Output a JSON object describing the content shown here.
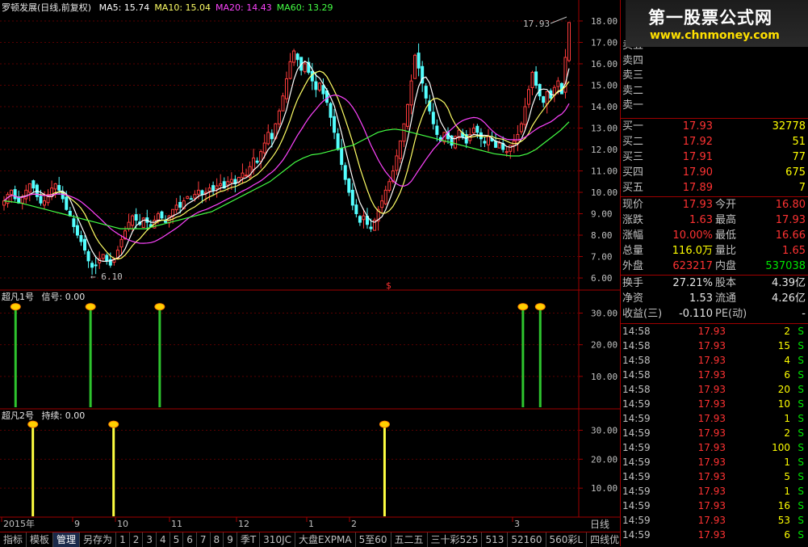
{
  "stock": {
    "name": "罗顿发展(日线,前复权)",
    "ma": [
      {
        "label": "MA5: 15.74",
        "color": "#ffffff"
      },
      {
        "label": "MA10: 15.04",
        "color": "#ffff66"
      },
      {
        "label": "MA20: 14.43",
        "color": "#ff44ff"
      },
      {
        "label": "MA60: 13.29",
        "color": "#44ff44"
      }
    ]
  },
  "chart_data": {
    "type": "candlestick",
    "price_axis": {
      "min": 5.7,
      "max": 18.3,
      "ticks": [
        "18.00",
        "17.00",
        "16.00",
        "15.00",
        "14.00",
        "13.00",
        "12.00",
        "11.00",
        "10.00",
        "9.00",
        "8.00",
        "7.00",
        "6.00"
      ]
    },
    "x_labels": [
      "2015年",
      "9",
      "10",
      "11",
      "12",
      "1",
      "2",
      "3"
    ],
    "annotations": {
      "high": "17.93",
      "low": "6.10"
    },
    "closes": [
      9.6,
      9.9,
      10.1,
      9.7,
      9.5,
      9.8,
      10.1,
      10.4,
      10.2,
      9.8,
      9.5,
      9.6,
      9.9,
      10.2,
      10.4,
      10.1,
      9.7,
      9.2,
      8.9,
      8.4,
      8.0,
      7.7,
      7.3,
      6.8,
      6.5,
      6.6,
      6.9,
      7.1,
      6.8,
      6.6,
      6.9,
      7.3,
      7.8,
      8.2,
      8.6,
      8.9,
      8.7,
      8.5,
      8.8,
      8.6,
      8.4,
      8.7,
      9.0,
      8.8,
      8.6,
      8.9,
      9.2,
      9.4,
      9.3,
      9.6,
      9.8,
      9.7,
      9.9,
      10.1,
      9.9,
      10.0,
      10.2,
      10.1,
      10.3,
      10.4,
      10.2,
      10.5,
      10.6,
      10.4,
      10.7,
      10.9,
      10.8,
      11.2,
      11.6,
      11.4,
      11.9,
      12.3,
      12.8,
      12.5,
      13.2,
      13.8,
      14.5,
      15.3,
      16.1,
      16.6,
      16.2,
      15.7,
      16.0,
      15.6,
      15.2,
      14.8,
      15.1,
      14.6,
      14.2,
      13.5,
      12.8,
      12.0,
      11.3,
      10.6,
      10.0,
      9.4,
      9.0,
      8.6,
      8.9,
      8.5,
      8.3,
      8.7,
      9.2,
      9.6,
      10.1,
      10.5,
      11.0,
      11.7,
      12.4,
      13.2,
      14.1,
      15.2,
      16.4,
      15.8,
      15.1,
      14.4,
      13.8,
      13.2,
      12.7,
      12.4,
      12.8,
      12.5,
      12.2,
      12.6,
      12.9,
      12.6,
      12.3,
      12.7,
      13.0,
      12.8,
      12.5,
      12.3,
      12.6,
      12.4,
      12.1,
      12.3,
      12.0,
      11.9,
      12.2,
      12.4,
      12.7,
      13.2,
      14.0,
      14.8,
      15.6,
      15.0,
      14.5,
      14.2,
      14.7,
      14.4,
      14.9,
      15.2,
      14.6,
      16.3,
      17.93
    ],
    "ma60": [
      9.6,
      9.55,
      9.5,
      9.4,
      9.3,
      9.2,
      9.1,
      9.0,
      8.9,
      8.8,
      8.7,
      8.6,
      8.5,
      8.4,
      8.3,
      8.3,
      8.3,
      8.3,
      8.4,
      8.5,
      8.6,
      8.7,
      8.8,
      8.9,
      9.0,
      9.1,
      9.3,
      9.5,
      9.7,
      9.9,
      10.1,
      10.3,
      10.5,
      10.8,
      11.1,
      11.4,
      11.6,
      11.75,
      11.8,
      11.9,
      12.0,
      12.1,
      12.2,
      12.4,
      12.6,
      12.8,
      12.9,
      12.95,
      12.9,
      12.8,
      12.7,
      12.6,
      12.5,
      12.4,
      12.3,
      12.2,
      12.1,
      12.0,
      11.9,
      11.8,
      11.75,
      11.7,
      11.7,
      11.8,
      12.0,
      12.3,
      12.6,
      12.9,
      13.29
    ],
    "signal1": {
      "label": "超凡1号",
      "value_label": "信号: 0.00",
      "axis_ticks": [
        "30.00",
        "20.00",
        "10.00"
      ],
      "bars": [
        2,
        15,
        27,
        90,
        93
      ]
    },
    "signal2": {
      "label": "超凡2号",
      "value_label": "持续: 0.00",
      "axis_ticks": [
        "30.00",
        "20.00",
        "10.00"
      ],
      "bars": [
        5,
        19,
        66
      ]
    }
  },
  "logo": {
    "title": "第一股票公式网",
    "url": "www.chnmoney.com"
  },
  "quotes": {
    "sell": [
      {
        "label": "卖五",
        "price": "",
        "vol": ""
      },
      {
        "label": "卖四",
        "price": "",
        "vol": ""
      },
      {
        "label": "卖三",
        "price": "",
        "vol": ""
      },
      {
        "label": "卖二",
        "price": "",
        "vol": ""
      },
      {
        "label": "卖一",
        "price": "",
        "vol": ""
      }
    ],
    "buy": [
      {
        "label": "买一",
        "price": "17.93",
        "vol": "32778"
      },
      {
        "label": "买二",
        "price": "17.92",
        "vol": "51"
      },
      {
        "label": "买三",
        "price": "17.91",
        "vol": "77"
      },
      {
        "label": "买四",
        "price": "17.90",
        "vol": "675"
      },
      {
        "label": "买五",
        "price": "17.89",
        "vol": "7"
      }
    ],
    "stats": [
      {
        "l1": "现价",
        "v1": "17.93",
        "c1": "red",
        "l2": "今开",
        "v2": "16.80",
        "c2": "red"
      },
      {
        "l1": "涨跌",
        "v1": "1.63",
        "c1": "red",
        "l2": "最高",
        "v2": "17.93",
        "c2": "red"
      },
      {
        "l1": "涨幅",
        "v1": "10.00%",
        "c1": "red",
        "l2": "最低",
        "v2": "16.66",
        "c2": "red"
      },
      {
        "l1": "总量",
        "v1": "116.0万",
        "c1": "yellow",
        "l2": "量比",
        "v2": "1.65",
        "c2": "red"
      },
      {
        "l1": "外盘",
        "v1": "623217",
        "c1": "red",
        "l2": "内盘",
        "v2": "537038",
        "c2": "green"
      }
    ],
    "fund": [
      {
        "l1": "换手",
        "v1": "27.21%",
        "l2": "股本",
        "v2": "4.39亿"
      },
      {
        "l1": "净资",
        "v1": "1.53",
        "l2": "流通",
        "v2": "4.26亿"
      },
      {
        "l1": "收益(三)",
        "v1": "-0.110",
        "l2": "PE(动)",
        "v2": "-"
      }
    ]
  },
  "trades": [
    {
      "time": "14:58",
      "price": "17.93",
      "vol": "2",
      "side": "S"
    },
    {
      "time": "14:58",
      "price": "17.93",
      "vol": "15",
      "side": "S"
    },
    {
      "time": "14:58",
      "price": "17.93",
      "vol": "4",
      "side": "S"
    },
    {
      "time": "14:58",
      "price": "17.93",
      "vol": "6",
      "side": "S"
    },
    {
      "time": "14:58",
      "price": "17.93",
      "vol": "20",
      "side": "S"
    },
    {
      "time": "14:59",
      "price": "17.93",
      "vol": "10",
      "side": "S"
    },
    {
      "time": "14:59",
      "price": "17.93",
      "vol": "1",
      "side": "S"
    },
    {
      "time": "14:59",
      "price": "17.93",
      "vol": "2",
      "side": "S"
    },
    {
      "time": "14:59",
      "price": "17.93",
      "vol": "100",
      "side": "S"
    },
    {
      "time": "14:59",
      "price": "17.93",
      "vol": "1",
      "side": "S"
    },
    {
      "time": "14:59",
      "price": "17.93",
      "vol": "5",
      "side": "S"
    },
    {
      "time": "14:59",
      "price": "17.93",
      "vol": "1",
      "side": "S"
    },
    {
      "time": "14:59",
      "price": "17.93",
      "vol": "16",
      "side": "S"
    },
    {
      "time": "14:59",
      "price": "17.93",
      "vol": "53",
      "side": "S"
    },
    {
      "time": "14:59",
      "price": "17.93",
      "vol": "6",
      "side": "S"
    }
  ],
  "tabs": [
    "指标",
    "模板",
    "管理",
    "另存为",
    "1",
    "2",
    "3",
    "4",
    "5",
    "6",
    "7",
    "8",
    "9",
    "季T",
    "310JC",
    "大盘EXPMA",
    "5至60",
    "五二五",
    "三十彩525",
    "513",
    "52160",
    "560彩L",
    "四线优"
  ],
  "active_tab": "管理",
  "day_label": "日线"
}
